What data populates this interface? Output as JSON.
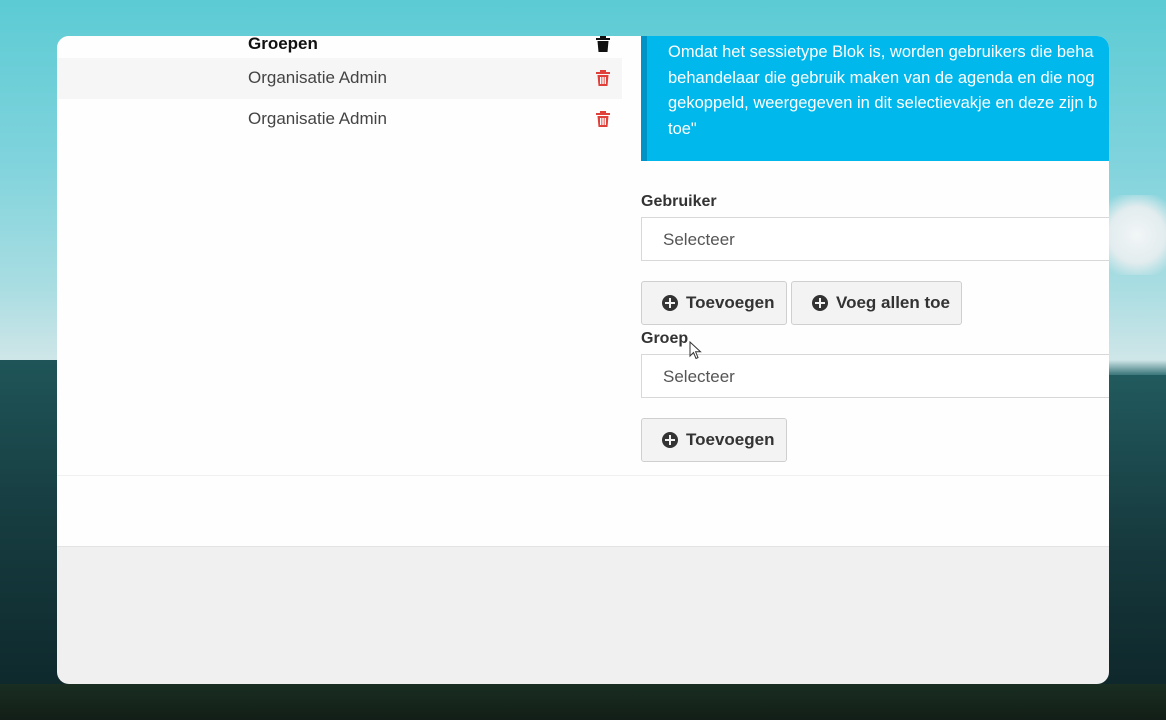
{
  "groups_list": {
    "header_label": "Groepen",
    "rows": [
      {
        "label": "Organisatie Admin"
      },
      {
        "label": "Organisatie Admin"
      }
    ]
  },
  "info": {
    "text": "Omdat het sessietype Blok is, worden gebruikers die beha\nbehandelaar die gebruik maken van de agenda en die nog\ngekoppeld, weergegeven in dit selectievakje en deze zijn b\ntoe\""
  },
  "user_field": {
    "label": "Gebruiker",
    "select_value": "Selecteer",
    "add_button": "Toevoegen",
    "add_all_button": "Voeg allen toe"
  },
  "group_field": {
    "label": "Groep",
    "select_value": "Selecteer",
    "add_button": "Toevoegen"
  },
  "colors": {
    "info_bg": "#00b8ec",
    "info_border": "#0094c6",
    "trash_red": "#e0403a"
  }
}
